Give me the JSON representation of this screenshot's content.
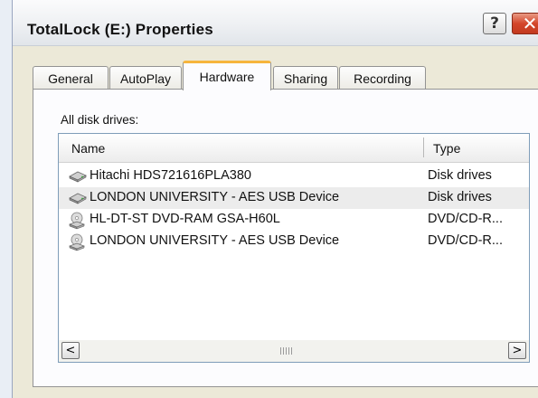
{
  "window": {
    "title": "TotalLock (E:) Properties",
    "help_glyph": "?",
    "close_glyph": "✕"
  },
  "tabs": [
    {
      "label": "General"
    },
    {
      "label": "AutoPlay"
    },
    {
      "label": "Hardware",
      "active": true
    },
    {
      "label": "Sharing"
    },
    {
      "label": "Recording"
    }
  ],
  "hardware": {
    "label": "All disk drives:",
    "columns": {
      "name": "Name",
      "type": "Type"
    },
    "devices": [
      {
        "name": "Hitachi HDS721616PLA380",
        "type": "Disk drives",
        "icon": "hard-disk-icon"
      },
      {
        "name": "LONDON UNIVERSITY - AES USB Device",
        "type": "Disk drives",
        "icon": "hard-disk-icon",
        "selected": true
      },
      {
        "name": "HL-DT-ST DVD-RAM GSA-H60L",
        "type": "DVD/CD-R...",
        "icon": "optical-drive-icon"
      },
      {
        "name": "LONDON UNIVERSITY - AES USB Device",
        "type": "DVD/CD-R...",
        "icon": "optical-drive-icon"
      }
    ],
    "scroll_left": "<",
    "scroll_right": ">"
  }
}
